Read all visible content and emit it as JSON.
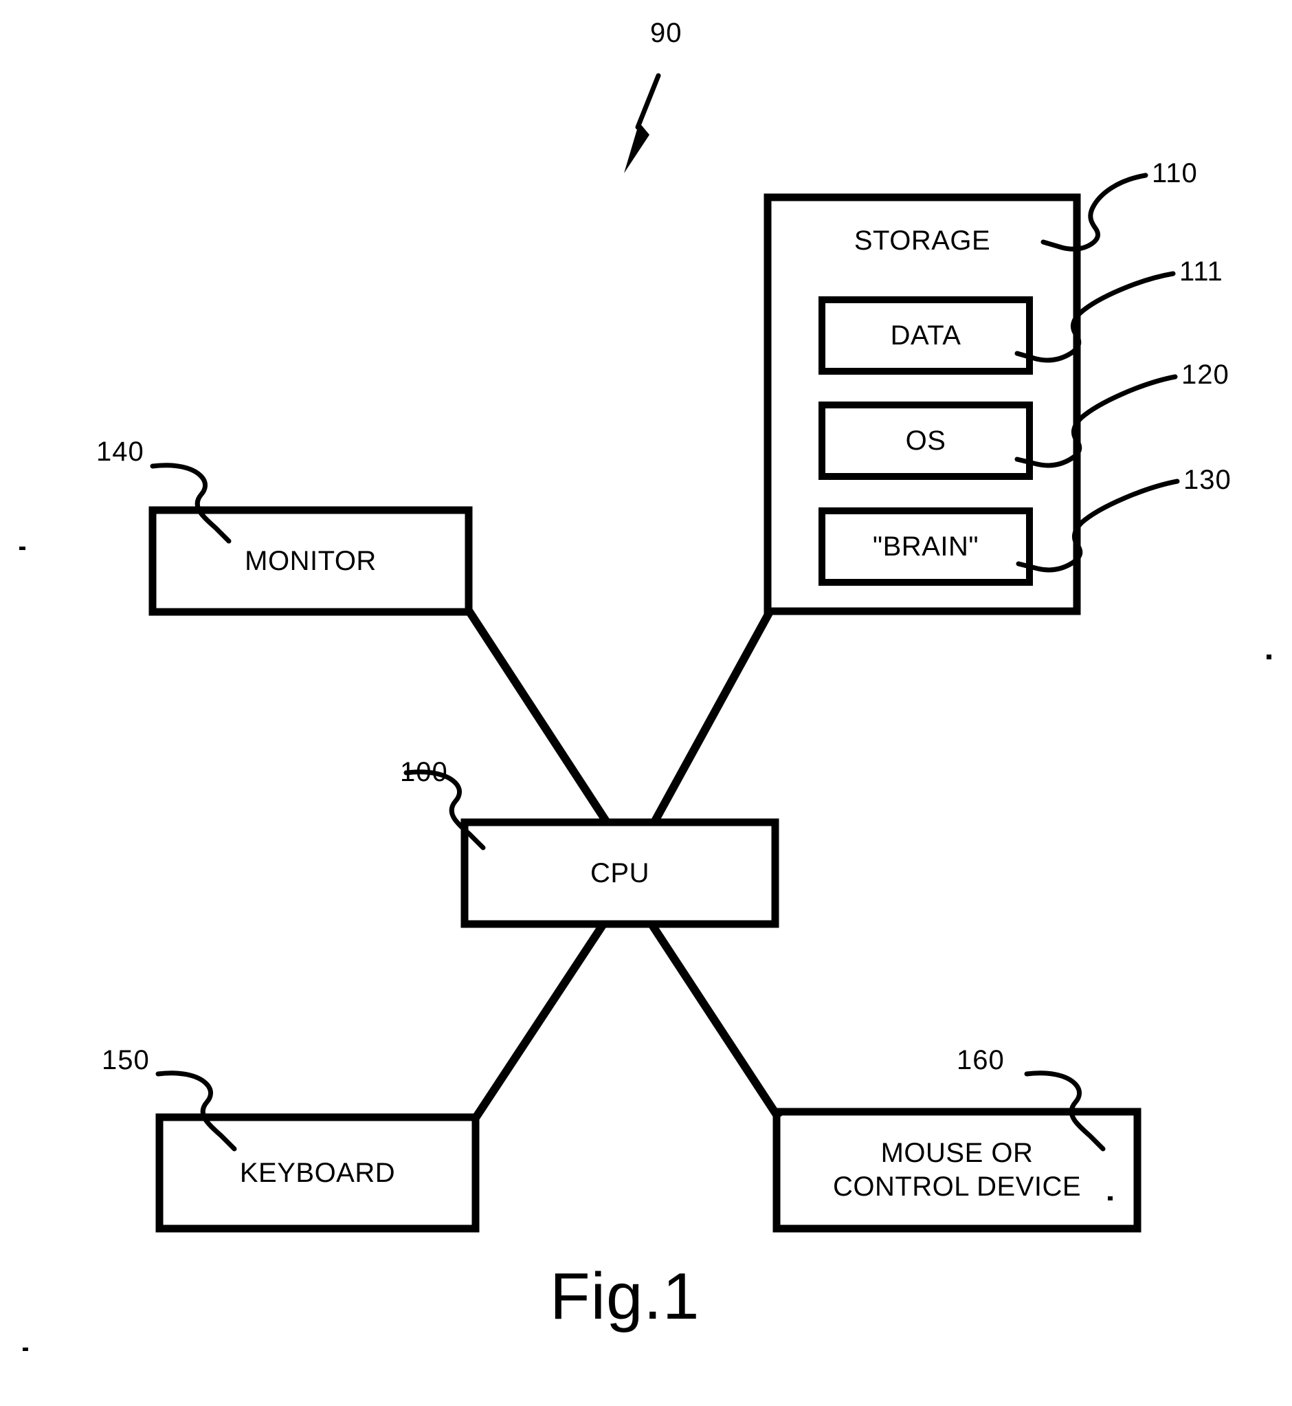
{
  "figure": {
    "caption": "Fig.1",
    "system_ref": "90"
  },
  "boxes": {
    "storage": {
      "label": "STORAGE",
      "ref": "110"
    },
    "data": {
      "label": "DATA",
      "ref": "111"
    },
    "os": {
      "label": "OS",
      "ref": "120"
    },
    "brain": {
      "label": "\"BRAIN\"",
      "ref": "130"
    },
    "monitor": {
      "label": "MONITOR",
      "ref": "140"
    },
    "cpu": {
      "label": "CPU",
      "ref": "100"
    },
    "keyboard": {
      "label": "KEYBOARD",
      "ref": "150"
    },
    "mouse": {
      "label": "MOUSE OR\nCONTROL DEVICE",
      "ref": "160"
    }
  },
  "colors": {
    "ink": "#000000",
    "paper": "#ffffff"
  }
}
